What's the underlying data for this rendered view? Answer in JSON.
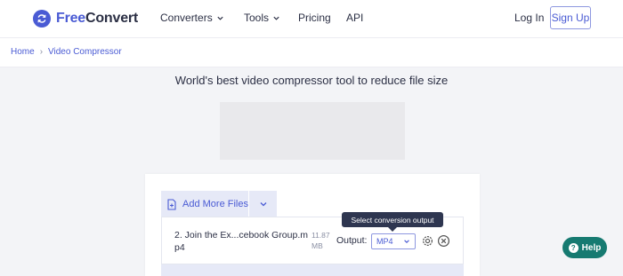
{
  "brand": {
    "free": "Free",
    "convert": "Convert"
  },
  "nav": {
    "converters": "Converters",
    "tools": "Tools",
    "pricing": "Pricing",
    "api": "API",
    "login": "Log In",
    "signup": "Sign Up"
  },
  "breadcrumb": {
    "home": "Home",
    "sep": "›",
    "current": "Video Compressor"
  },
  "headline": "World's best video compressor tool to reduce file size",
  "upload": {
    "add_more_label": "Add More Files",
    "file_name": "2. Join the Ex...cebook Group.mp4",
    "file_size": "11.87 MB",
    "output_label": "Output:",
    "selected_format": "MP4",
    "tooltip": "Select conversion output"
  },
  "help": {
    "label": "Help",
    "glyph": "?"
  },
  "colors": {
    "accent": "#4a5bd4",
    "help": "#167a71",
    "tooltip_bg": "#2e3650"
  }
}
